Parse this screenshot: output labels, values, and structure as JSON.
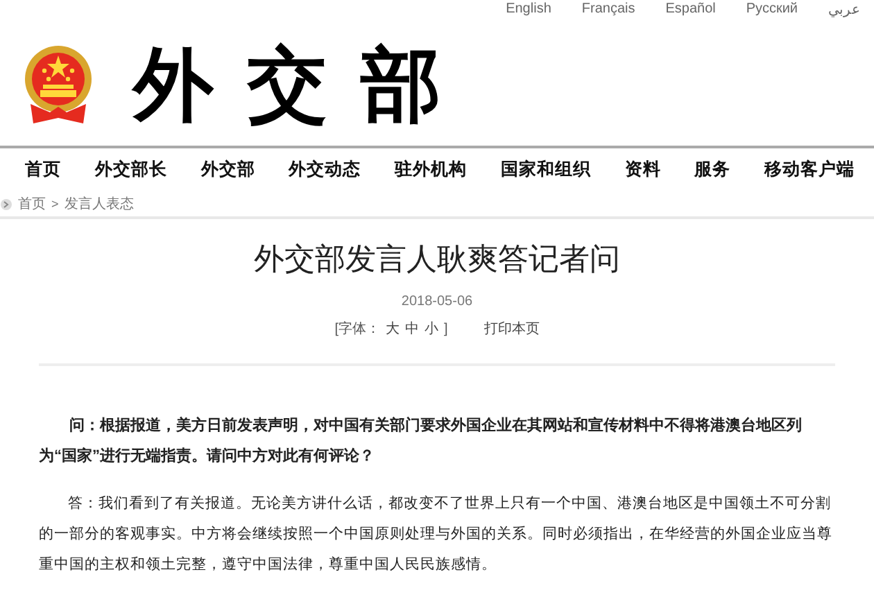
{
  "languages": [
    "English",
    "Français",
    "Español",
    "Русский",
    "عربي"
  ],
  "logo": {
    "text": "外交部"
  },
  "nav": [
    "首页",
    "外交部长",
    "外交部",
    "外交动态",
    "驻外机构",
    "国家和组织",
    "资料",
    "服务",
    "移动客户端"
  ],
  "breadcrumb": {
    "items": [
      "首页",
      "发言人表态"
    ],
    "separator": ">"
  },
  "article": {
    "title": "外交部发言人耿爽答记者问",
    "date": "2018-05-06",
    "font_size": {
      "label_open": "[字体：",
      "options": [
        "大",
        "中",
        "小"
      ],
      "label_close": "]"
    },
    "print": "打印本页",
    "paragraphs": [
      {
        "kind": "question",
        "text": "问：根据报道，美方日前发表声明，对中国有关部门要求外国企业在其网站和宣传材料中不得将港澳台地区列为“国家”进行无端指责。请问中方对此有何评论？"
      },
      {
        "kind": "answer",
        "text": "答：我们看到了有关报道。无论美方讲什么话，都改变不了世界上只有一个中国、港澳台地区是中国领土不可分割的一部分的客观事实。中方将会继续按照一个中国原则处理与外国的关系。同时必须指出，在华经营的外国企业应当尊重中国的主权和领土完整，遵守中国法律，尊重中国人民民族感情。"
      }
    ]
  }
}
